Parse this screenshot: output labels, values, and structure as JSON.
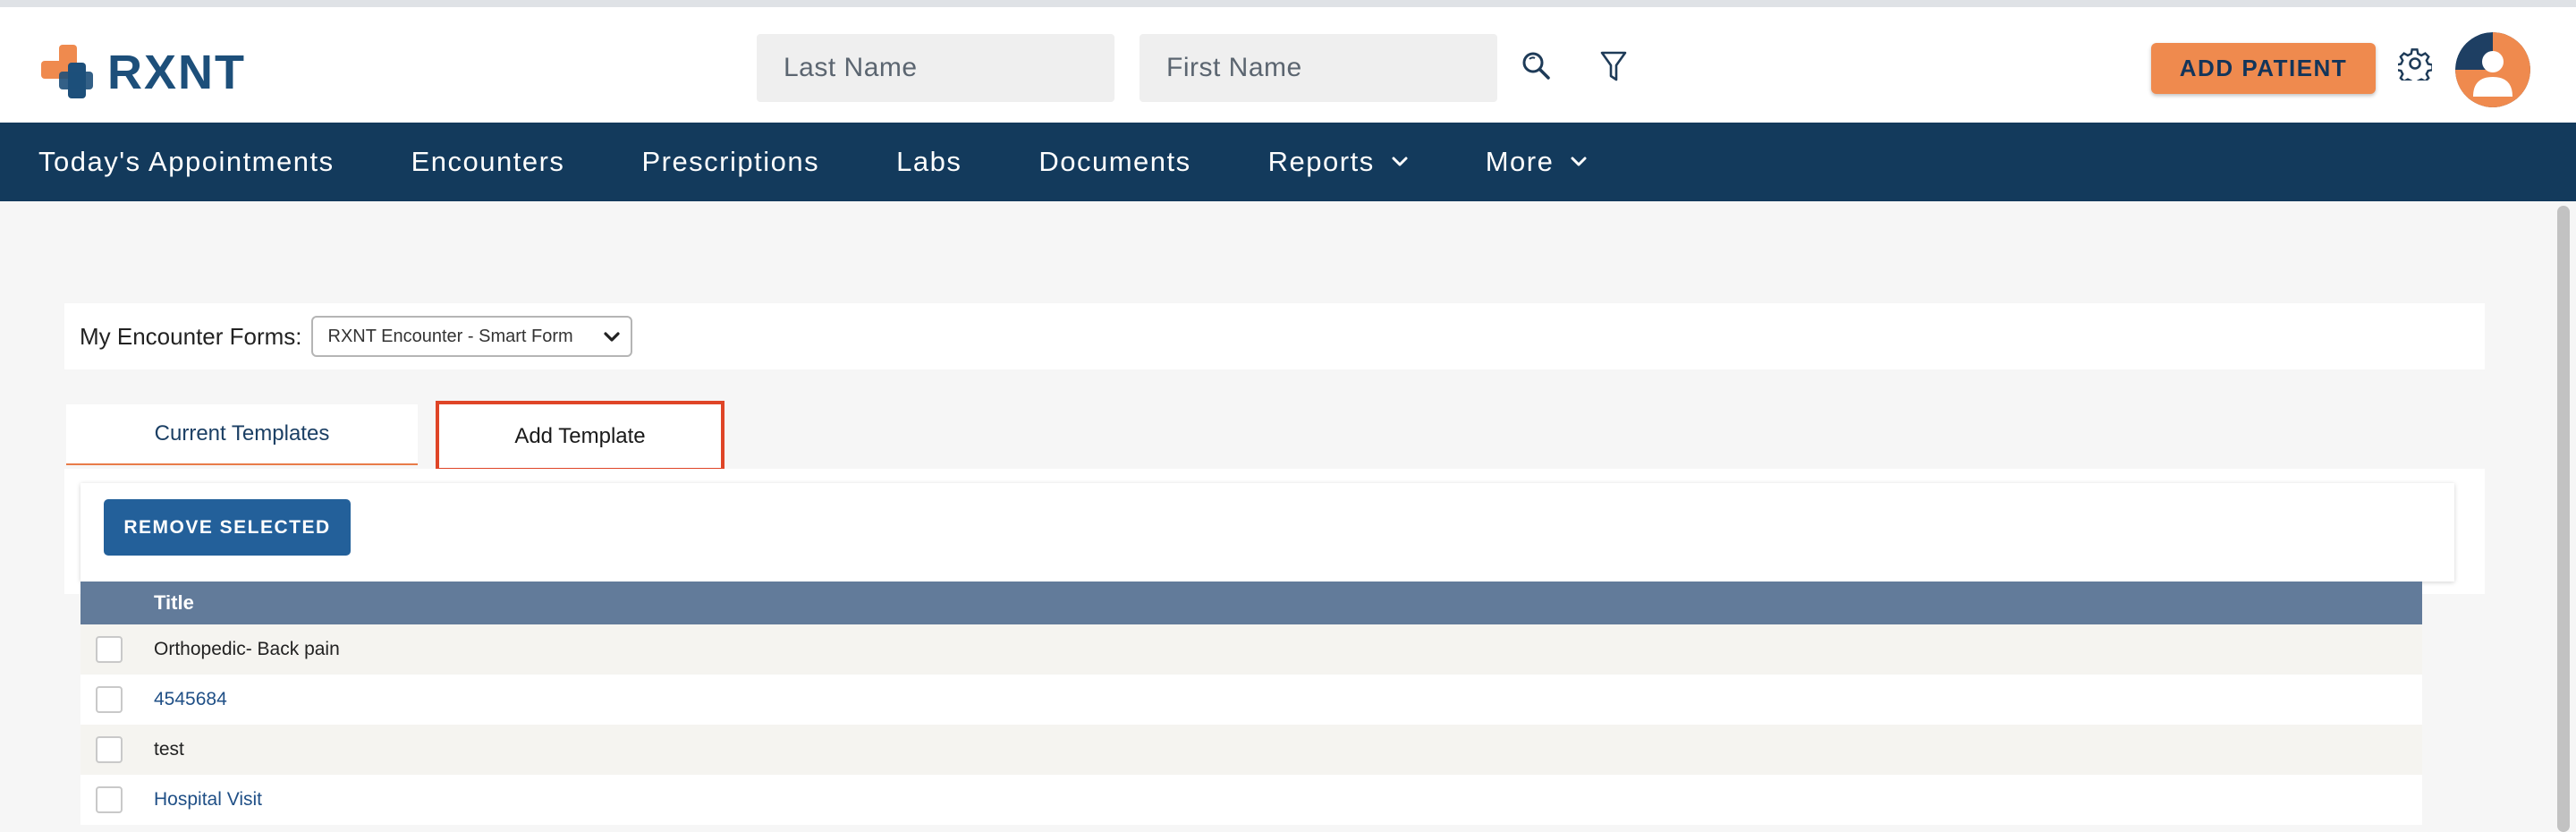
{
  "app": {
    "logo_text": "RXNT",
    "brand_colors": {
      "primary": "#133a5c",
      "accent": "#ef8a4e",
      "logo_blue": "#1d4f7a"
    }
  },
  "header": {
    "last_name_placeholder": "Last Name",
    "first_name_placeholder": "First Name",
    "search_icon": "search-icon",
    "filter_icon": "filter-icon",
    "add_patient_label": "ADD PATIENT",
    "settings_icon": "gear-icon",
    "avatar_icon": "user-avatar-icon"
  },
  "nav": {
    "items": [
      {
        "label": "Today's Appointments",
        "dropdown": false
      },
      {
        "label": "Encounters",
        "dropdown": false
      },
      {
        "label": "Prescriptions",
        "dropdown": false
      },
      {
        "label": "Labs",
        "dropdown": false
      },
      {
        "label": "Documents",
        "dropdown": false
      },
      {
        "label": "Reports",
        "dropdown": true
      },
      {
        "label": "More",
        "dropdown": true
      }
    ]
  },
  "forms": {
    "label": "My Encounter Forms:",
    "selected": "RXNT Encounter - Smart Form"
  },
  "tabs": {
    "current_label": "Current Templates",
    "add_label": "Add Template"
  },
  "actions": {
    "remove_selected_label": "REMOVE SELECTED"
  },
  "table": {
    "header_title": "Title",
    "rows": [
      {
        "title": "Orthopedic- Back pain"
      },
      {
        "title": "4545684"
      },
      {
        "title": "test"
      },
      {
        "title": "Hospital Visit"
      }
    ]
  }
}
